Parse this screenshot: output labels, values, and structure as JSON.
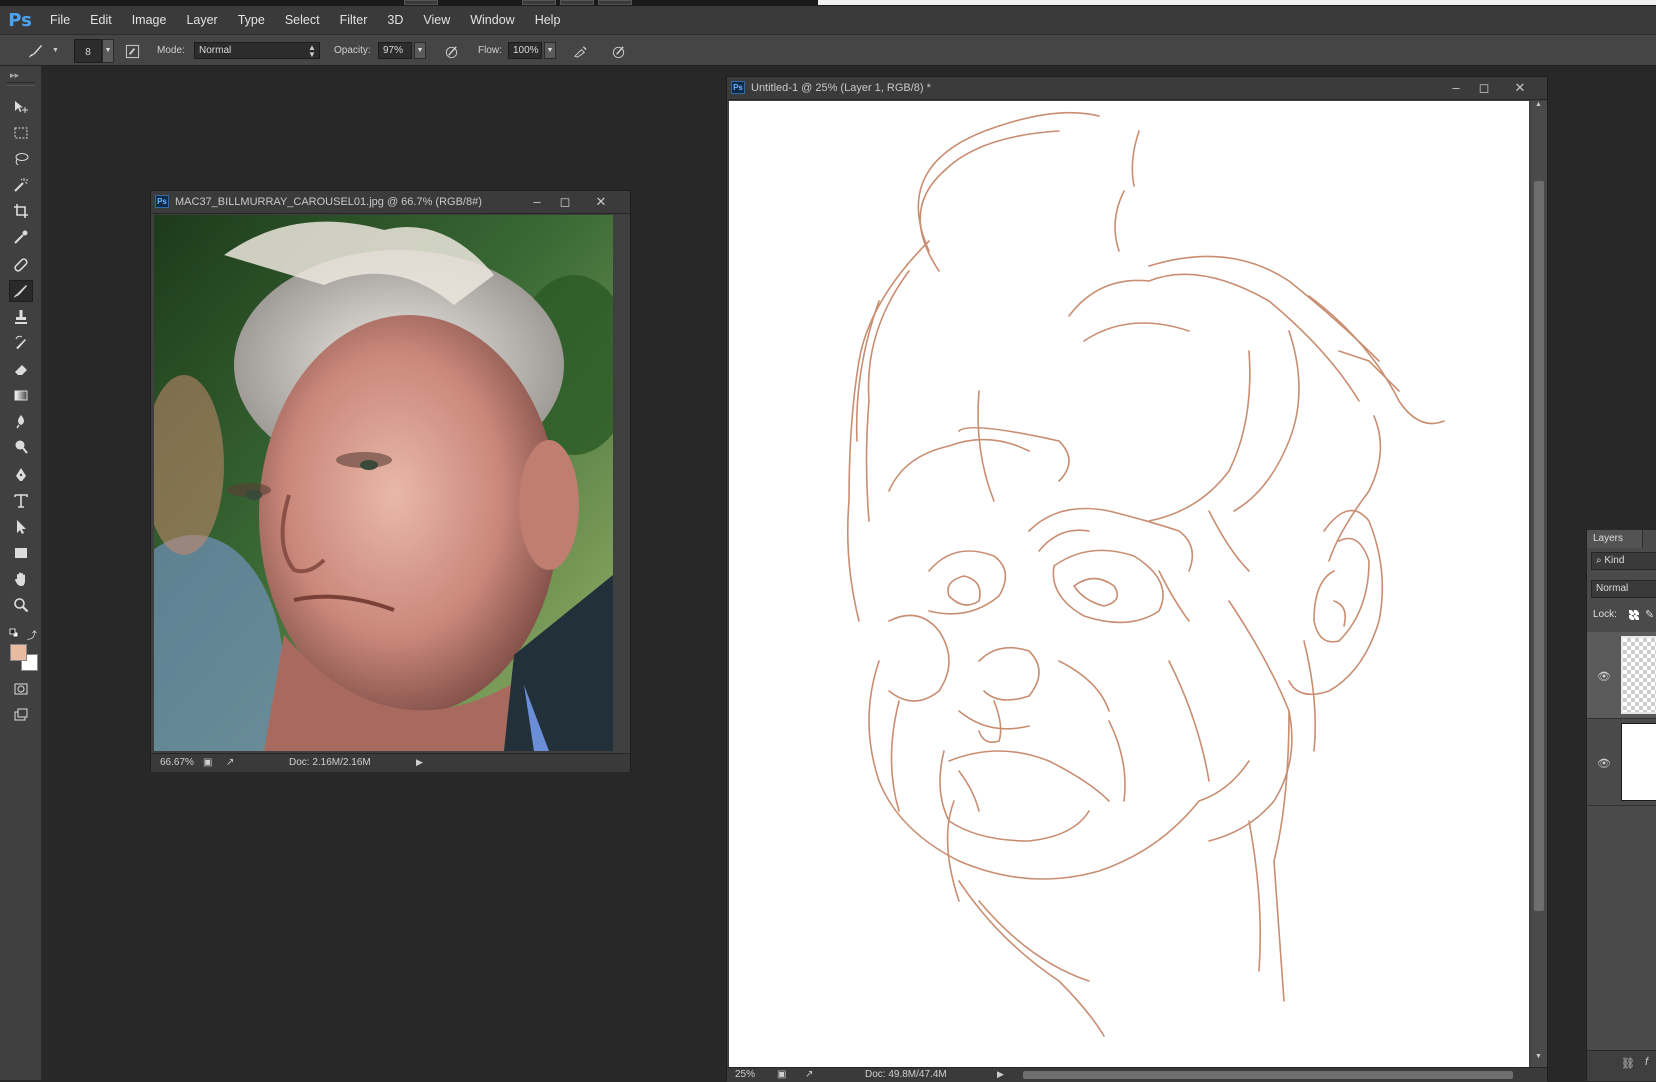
{
  "app": {
    "logo": "Ps"
  },
  "menu": [
    "File",
    "Edit",
    "Image",
    "Layer",
    "Type",
    "Select",
    "Filter",
    "3D",
    "View",
    "Window",
    "Help"
  ],
  "options_bar": {
    "brush_size": "8",
    "mode_label": "Mode:",
    "mode_value": "Normal",
    "opacity_label": "Opacity:",
    "opacity_value": "97%",
    "flow_label": "Flow:",
    "flow_value": "100%"
  },
  "colors": {
    "foreground": "#e8bba0",
    "background": "#ffffff",
    "sketch_stroke": "#c98e72",
    "accent": "#4aa3f0"
  },
  "tools": [
    "move-tool",
    "marquee-tool",
    "lasso-tool",
    "magic-wand-tool",
    "crop-tool",
    "eyedropper-tool",
    "healing-brush-tool",
    "brush-tool",
    "clone-stamp-tool",
    "history-brush-tool",
    "eraser-tool",
    "gradient-tool",
    "blur-tool",
    "dodge-tool",
    "pen-tool",
    "type-tool",
    "path-selection-tool",
    "rectangle-tool",
    "hand-tool",
    "zoom-tool"
  ],
  "reference_doc": {
    "title": "MAC37_BILLMURRAY_CAROUSEL01.jpg @ 66.7% (RGB/8#)",
    "zoom": "66.67%",
    "doc_info": "Doc: 2.16M/2.16M"
  },
  "sketch_doc": {
    "title": "Untitled-1 @ 25% (Layer 1, RGB/8) *",
    "zoom": "25%",
    "doc_info": "Doc: 49.8M/47.4M"
  },
  "layers_panel": {
    "tab": "Layers",
    "filter": "Kind",
    "blend_mode": "Normal",
    "lock_label": "Lock:"
  }
}
